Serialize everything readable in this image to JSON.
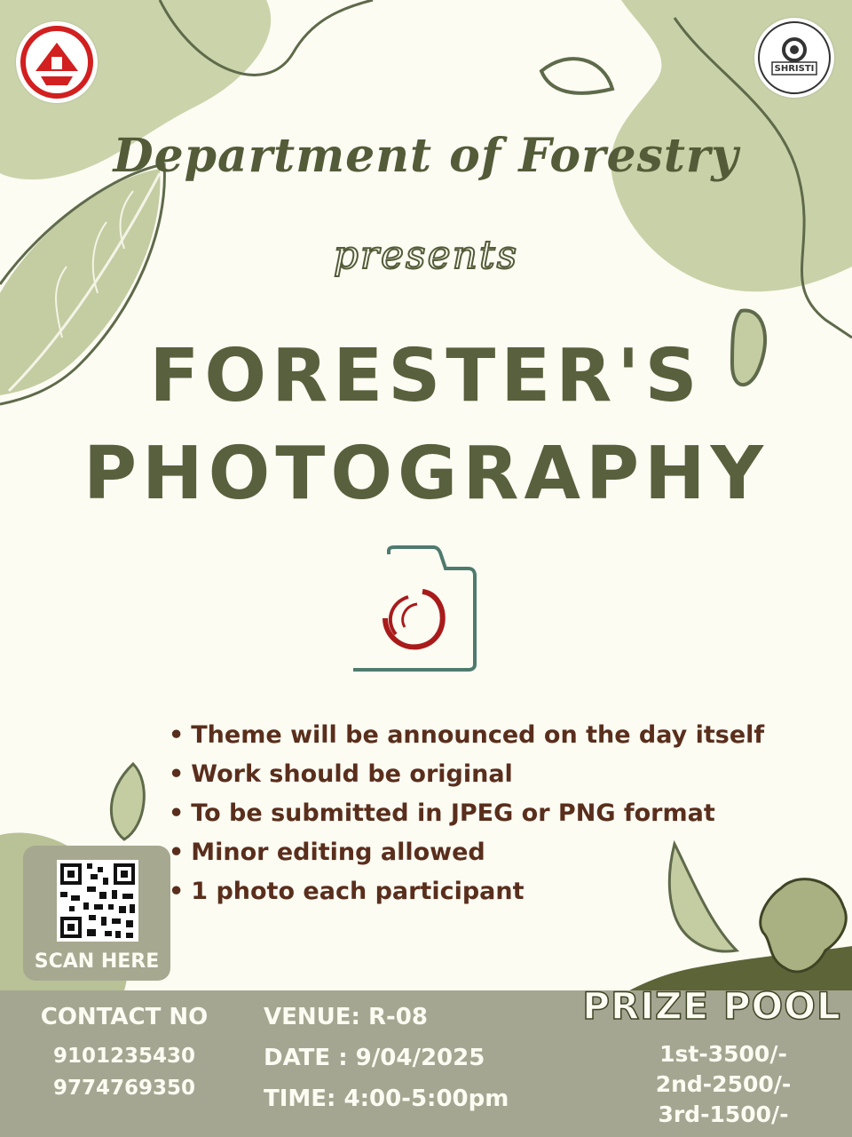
{
  "header": {
    "left_logo_icon": "institute-emblem-icon",
    "right_logo_icon": "shristi-fest-logo-icon",
    "right_logo_text": "SHRISTI"
  },
  "title": {
    "department": "Department of Forestry",
    "presents": "presents",
    "event_line1": "FORESTER'S",
    "event_line2": "PHOTOGRAPHY"
  },
  "camera_icon": "camera-icon",
  "rules": [
    "Theme will be announced on the day itself",
    "Work should be original",
    "To be submitted in JPEG or PNG format",
    "Minor editing allowed",
    "1 photo each participant"
  ],
  "bullet": "•",
  "qr": {
    "icon": "qr-code-icon",
    "label": "SCAN HERE"
  },
  "contact": {
    "title": "CONTACT NO",
    "numbers": [
      "9101235430",
      "9774769350"
    ]
  },
  "event_info": {
    "venue": "VENUE: R-08",
    "date": "DATE : 9/04/2025",
    "time": "TIME: 4:00-5:00pm"
  },
  "prize": {
    "title": "PRIZE POOL",
    "lines": [
      "1st-3500/-",
      "2nd-2500/-",
      "3rd-1500/-"
    ]
  },
  "colors": {
    "background": "#fcfcf3",
    "olive_dark": "#535b38",
    "sage": "#c7cfa5",
    "band": "#a5a691",
    "rules_text": "#5a2e1c",
    "camera_red": "#a91b1b",
    "camera_teal": "#4f7a6e"
  }
}
